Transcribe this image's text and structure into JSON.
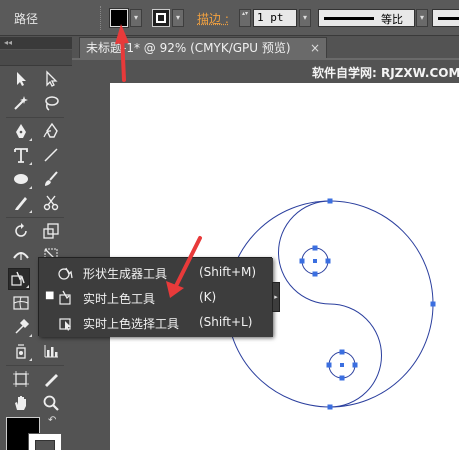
{
  "control_bar": {
    "title": "路径",
    "stroke_label": "描边 :",
    "stroke_weight": "1 pt",
    "profile_label": "等比",
    "dropdown_glyph": "▾",
    "stepper_glyph": "▴▾"
  },
  "tools_panel": {
    "collapse_glyph": "◂◂",
    "swap_glyph": "↶"
  },
  "document": {
    "tab_title": "未标题-1* @ 92% (CMYK/GPU 预览)",
    "tab_close": "×",
    "watermark": "软件自学网: RJZXW.COM"
  },
  "flyout_menu": {
    "items": [
      {
        "label": "形状生成器工具",
        "shortcut": "(Shift+M)",
        "checked": false,
        "icon": "shape-builder-icon"
      },
      {
        "label": "实时上色工具",
        "shortcut": "(K)",
        "checked": true,
        "icon": "live-paint-bucket-icon"
      },
      {
        "label": "实时上色选择工具",
        "shortcut": "(Shift+L)",
        "checked": false,
        "icon": "live-paint-selection-icon"
      }
    ],
    "check_glyph": "■",
    "tearoff_glyph": "▸"
  },
  "colors": {
    "fill": "#000000",
    "path_stroke": "#2b3f9e",
    "anchor": "#3b6fe0",
    "annotation_arrow": "#e83a3a"
  }
}
